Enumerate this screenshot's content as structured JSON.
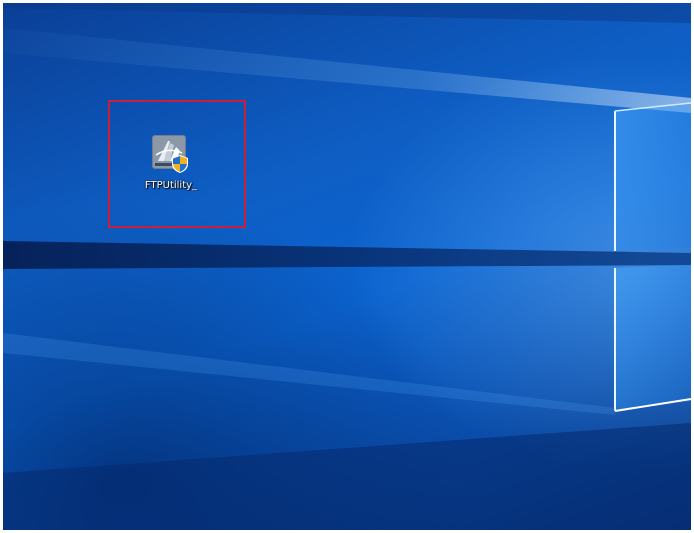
{
  "desktop": {
    "wallpaper": "windows-10-hero-light-window",
    "background_color": "#0b63cf",
    "icons": [
      {
        "label": "FTPUtility_",
        "icon": "ftp-utility-installer-icon"
      }
    ]
  },
  "annotation": {
    "highlight_color": "#c8203a"
  }
}
